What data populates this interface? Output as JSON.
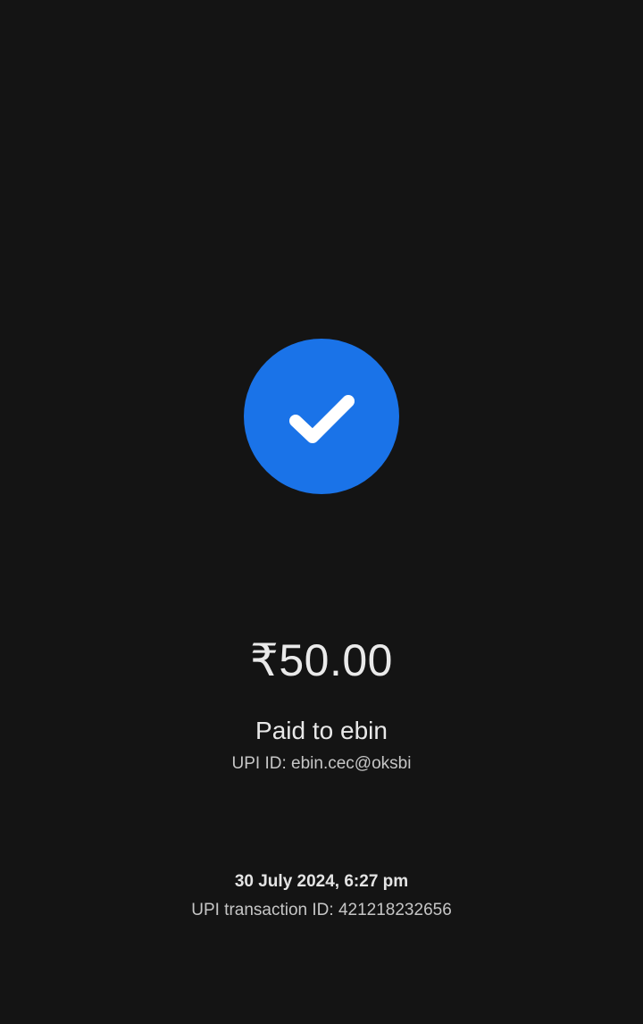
{
  "status": {
    "icon": "check-icon",
    "accent_color": "#1a73e8"
  },
  "payment": {
    "amount": "₹50.00",
    "paid_to": "Paid to ebin",
    "upi_id": "UPI ID: ebin.cec@oksbi"
  },
  "transaction": {
    "datetime": "30 July 2024, 6:27 pm",
    "id": "UPI transaction ID: 421218232656"
  }
}
